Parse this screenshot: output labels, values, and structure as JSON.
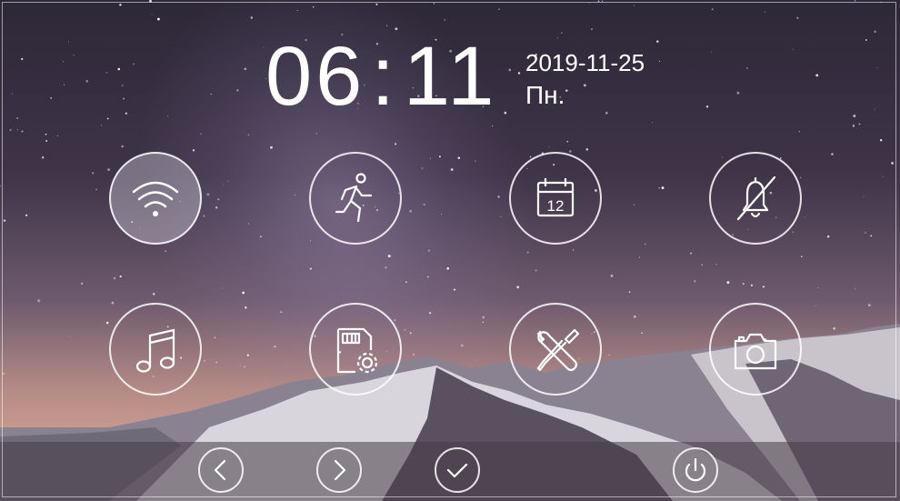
{
  "status": {
    "time_hours": "06",
    "time_separator": ":",
    "time_minutes": "11",
    "date": "2019-11-25",
    "weekday": "Пн."
  },
  "menu": {
    "tiles": [
      {
        "icon": "wifi-icon",
        "active": true
      },
      {
        "icon": "motion-detection-icon",
        "active": false
      },
      {
        "icon": "calendar-icon",
        "active": false,
        "calendar_day": "12"
      },
      {
        "icon": "bell-muted-icon",
        "active": false
      },
      {
        "icon": "music-note-icon",
        "active": false
      },
      {
        "icon": "sd-card-settings-icon",
        "active": false
      },
      {
        "icon": "tools-icon",
        "active": false
      },
      {
        "icon": "camera-icon",
        "active": false
      }
    ]
  },
  "bottom_nav": [
    {
      "icon": "chevron-left-icon"
    },
    {
      "icon": "chevron-right-icon"
    },
    {
      "icon": "check-icon"
    },
    {
      "icon": "power-icon"
    }
  ],
  "colors": {
    "foreground": "#ffffff",
    "active_tile_fill": "rgba(230,230,240,0.35)"
  }
}
